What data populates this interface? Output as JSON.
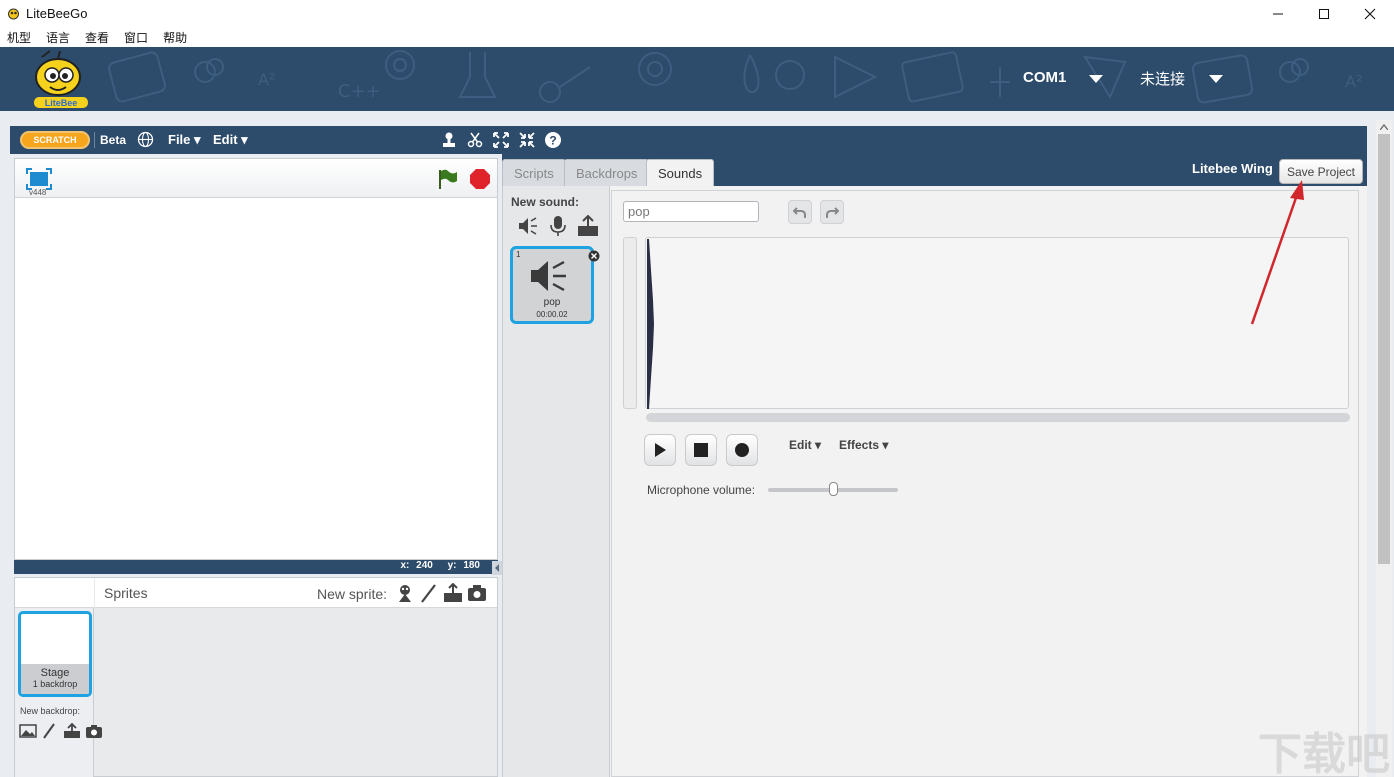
{
  "window": {
    "title": "LiteBeeGo"
  },
  "menubar": {
    "items": [
      "机型",
      "语言",
      "查看",
      "窗口",
      "帮助"
    ]
  },
  "banner": {
    "port": "COM1",
    "connection_status": "未连接",
    "logo_icon": "litebee-bee-logo"
  },
  "scratch_toolbar": {
    "logo_text": "SCRATCH",
    "beta_label": "Beta",
    "file_menu": "File ▾",
    "edit_menu": "Edit ▾",
    "tools": [
      "duplicate-stamp-icon",
      "cut-scissors-icon",
      "grow-icon",
      "shrink-icon",
      "help-icon"
    ]
  },
  "stage": {
    "version": "v448",
    "coords": {
      "x_label": "x:",
      "x": "240",
      "y_label": "y:",
      "y": "180"
    }
  },
  "sprites": {
    "title": "Sprites",
    "new_sprite_label": "New sprite:",
    "stage_thumb": {
      "name": "Stage",
      "detail": "1 backdrop"
    },
    "new_backdrop_label": "New backdrop:"
  },
  "tabs": [
    {
      "label": "Scripts",
      "active": false
    },
    {
      "label": "Backdrops",
      "active": false
    },
    {
      "label": "Sounds",
      "active": true
    }
  ],
  "project": {
    "name": "Litebee Wing",
    "save_label": "Save Project"
  },
  "sounds": {
    "new_sound_label": "New sound:",
    "items": [
      {
        "index": "1",
        "name": "pop",
        "duration": "00:00.02"
      }
    ],
    "editor": {
      "sound_name_value": "pop",
      "edit_menu": "Edit ▾",
      "effects_menu": "Effects ▾",
      "mic_label": "Microphone volume:",
      "mic_volume": 0.5
    }
  },
  "watermark": "下载吧",
  "colors": {
    "banner": "#2d4b6b",
    "accent_blue": "#1ea2e1",
    "stop_red": "#e0232b",
    "flag_green": "#3a7a1e"
  }
}
